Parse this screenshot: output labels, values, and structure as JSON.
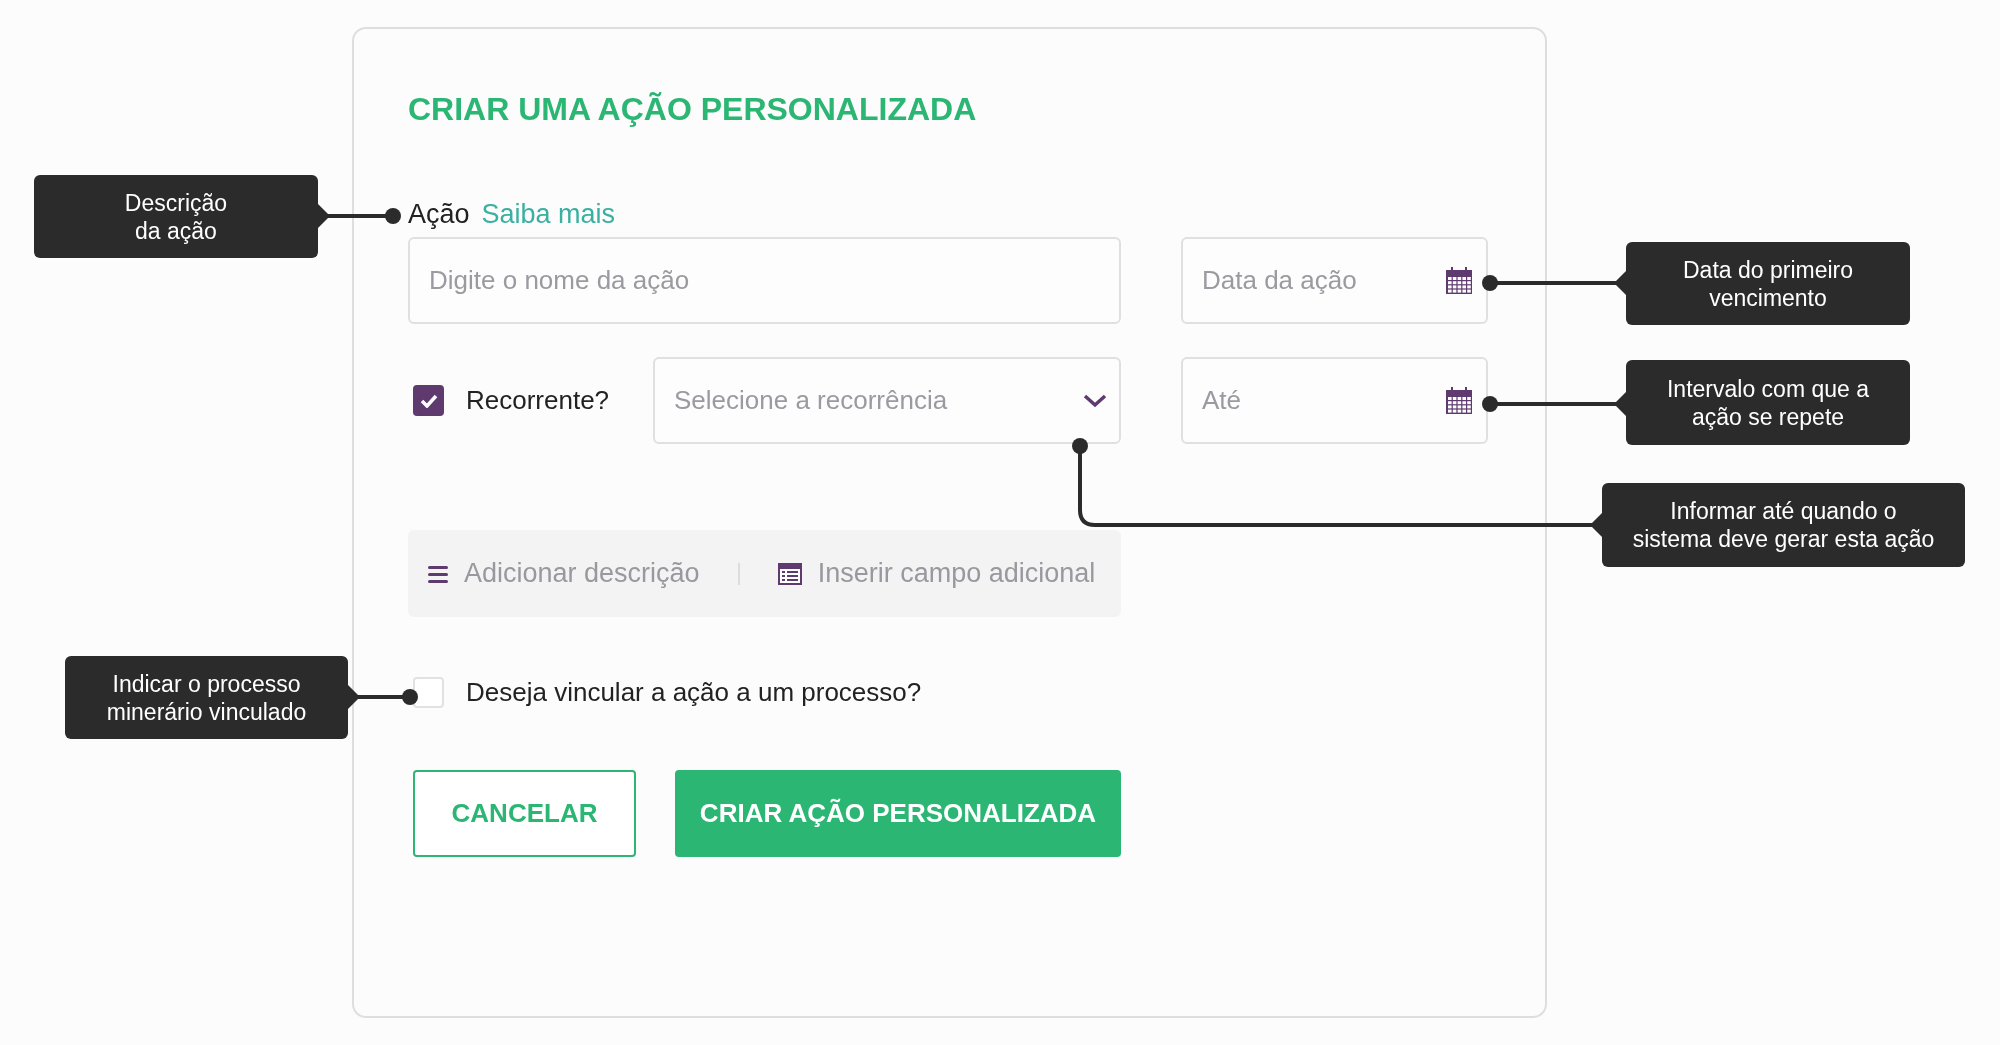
{
  "title": "CRIAR UMA AÇÃO PERSONALIZADA",
  "action_label": {
    "label": "Ação",
    "link": "Saiba mais"
  },
  "name_field": {
    "placeholder": "Digite o nome da ação"
  },
  "date_field": {
    "placeholder": "Data da ação"
  },
  "recurrent": {
    "label": "Recorrente?",
    "checked": true
  },
  "recurrence_select": {
    "placeholder": "Selecione a recorrência"
  },
  "until_field": {
    "placeholder": "Até"
  },
  "toolbar": [
    {
      "label": "Adicionar descrição",
      "kind": "text"
    },
    {
      "label": "Inserir campo adicional",
      "kind": "form"
    }
  ],
  "link_process": {
    "label": "Deseja vincular a ação a um processo?",
    "checked": false
  },
  "buttons": [
    {
      "label": "CANCELAR",
      "kind": "secondary"
    },
    {
      "label": "CRIAR AÇÃO PERSONALIZADA",
      "kind": "primary"
    }
  ],
  "callouts": [
    {
      "text": "Descrição\nda ação"
    },
    {
      "text": "Data do primeiro\nvencimento"
    },
    {
      "text": "Intervalo com que a\nação se repete"
    },
    {
      "text": "Informar até quando o\nsistema deve gerar esta ação"
    },
    {
      "text": "Indicar o processo\nminerário vinculado"
    }
  ]
}
